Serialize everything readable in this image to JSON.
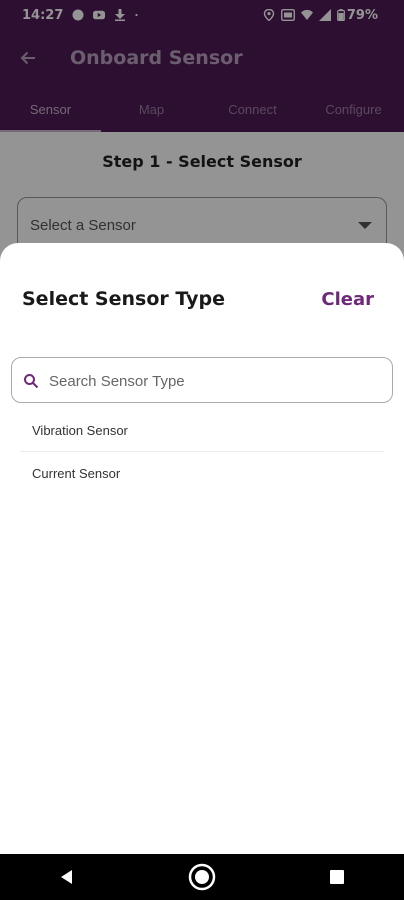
{
  "status_bar": {
    "time": "14:27",
    "battery": "79%",
    "icons": [
      "chat-bubble-icon",
      "youtube-icon",
      "download-icon",
      "dot-icon",
      "location-icon",
      "nfc-icon",
      "wifi-icon",
      "signal-icon",
      "battery-icon"
    ]
  },
  "app_bar": {
    "title": "Onboard Sensor",
    "back_icon": "arrow-left-icon"
  },
  "tabs": [
    {
      "label": "Sensor",
      "active": true
    },
    {
      "label": "Map",
      "active": false
    },
    {
      "label": "Connect",
      "active": false
    },
    {
      "label": "Configure",
      "active": false
    }
  ],
  "main": {
    "step_title": "Step 1 - Select Sensor",
    "select_placeholder": "Select a Sensor"
  },
  "sheet": {
    "title": "Select Sensor Type",
    "clear_label": "Clear",
    "search_placeholder": "Search Sensor Type",
    "search_value": "",
    "items": [
      {
        "label": "Vibration Sensor"
      },
      {
        "label": "Current Sensor"
      }
    ]
  },
  "nav_bar": {
    "icons": [
      "back-triangle-icon",
      "home-circle-icon",
      "recents-square-icon"
    ]
  },
  "colors": {
    "primary": "#4f1a57",
    "accent": "#6e2a78"
  }
}
